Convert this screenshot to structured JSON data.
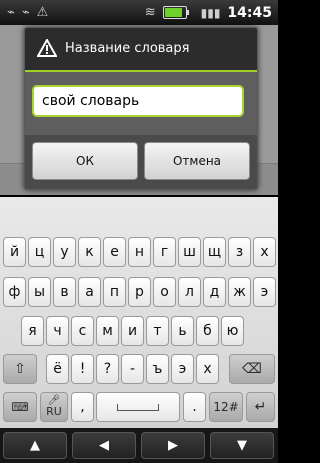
{
  "status_bar": {
    "time": "14:45",
    "icons": [
      "usb-icon",
      "usb-icon",
      "warning-icon",
      "wifi-icon",
      "battery-icon",
      "signal-icon"
    ]
  },
  "dialog": {
    "title": "Название словаря",
    "input_value": "свой словарь",
    "ok_label": "ОК",
    "cancel_label": "Отмена"
  },
  "keyboard": {
    "row1": [
      "й",
      "ц",
      "у",
      "к",
      "е",
      "н",
      "г",
      "ш",
      "щ",
      "з",
      "х"
    ],
    "row2": [
      "ф",
      "ы",
      "в",
      "а",
      "п",
      "р",
      "о",
      "л",
      "д",
      "ж",
      "э"
    ],
    "row3": [
      "я",
      "ч",
      "с",
      "м",
      "и",
      "т",
      "ь",
      "б",
      "ю"
    ],
    "row4": [
      "ё",
      "!",
      "?",
      "-",
      "ъ",
      "э",
      "х"
    ],
    "lang_label": "RU",
    "comma_label": ",",
    "period_label": ".",
    "numbers_label": "12#",
    "nav": [
      "up-arrow-icon",
      "left-arrow-icon",
      "right-arrow-icon",
      "down-arrow-icon"
    ]
  },
  "colors": {
    "accent": "#9fcf28",
    "dialog_bg": "#2c2c2c"
  }
}
